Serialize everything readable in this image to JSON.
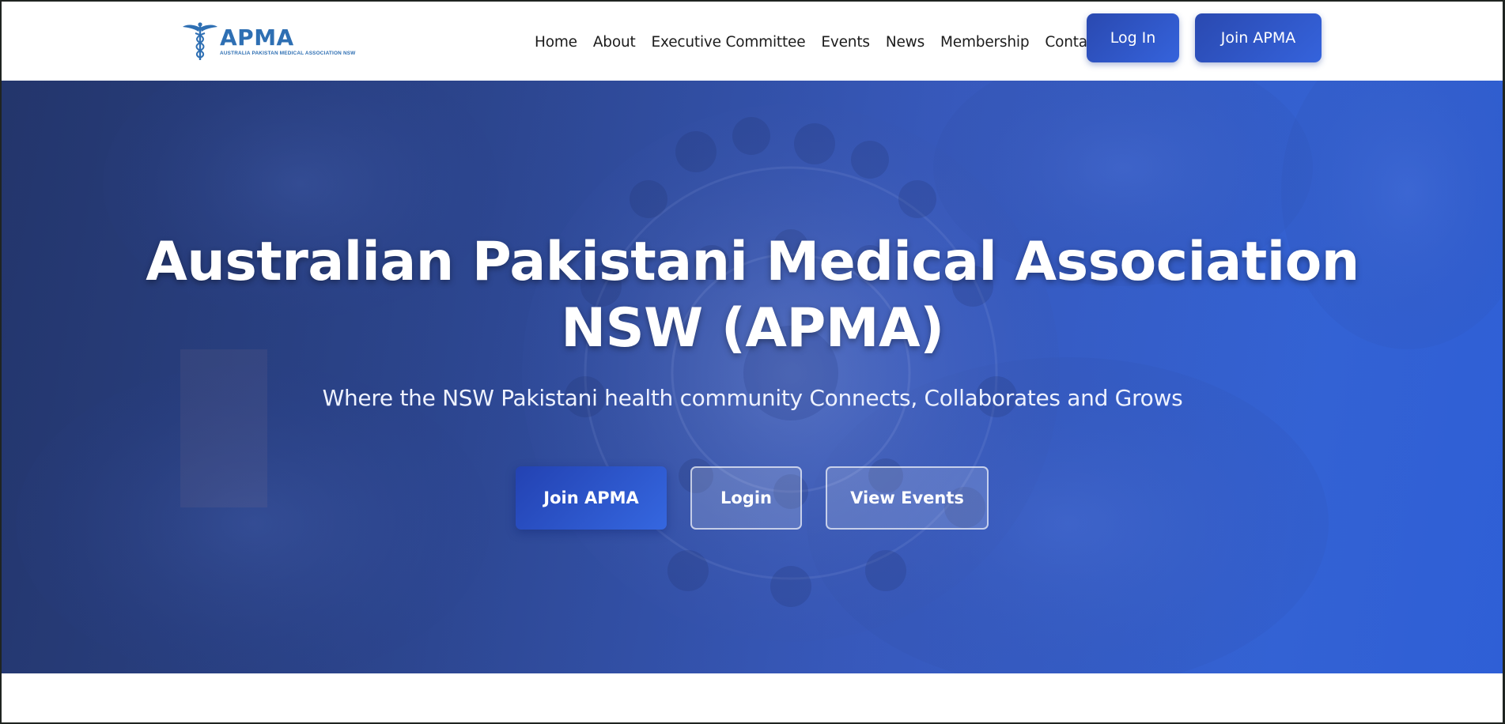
{
  "brand": {
    "name": "APMA",
    "tagline": "AUSTRALIA PAKISTAN MEDICAL ASSOCIATION NSW",
    "color": "#2e6fb3"
  },
  "nav": {
    "items": [
      {
        "label": "Home"
      },
      {
        "label": "About"
      },
      {
        "label": "Executive Committee"
      },
      {
        "label": "Events"
      },
      {
        "label": "News"
      },
      {
        "label": "Membership"
      },
      {
        "label": "Contact"
      }
    ],
    "login_label": "Log In",
    "join_label": "Join APMA"
  },
  "hero": {
    "title_line1": "Australian Pakistani Medical Association",
    "title_line2": "NSW (APMA)",
    "subtitle": "Where the NSW Pakistani health community Connects, Collaborates and Grows",
    "buttons": {
      "join": "Join APMA",
      "login": "Login",
      "events": "View Events"
    },
    "background": "surgical-team-operating-lights",
    "overlay_color": "#3564d6"
  },
  "icons": {
    "logo": "caduceus-icon"
  }
}
